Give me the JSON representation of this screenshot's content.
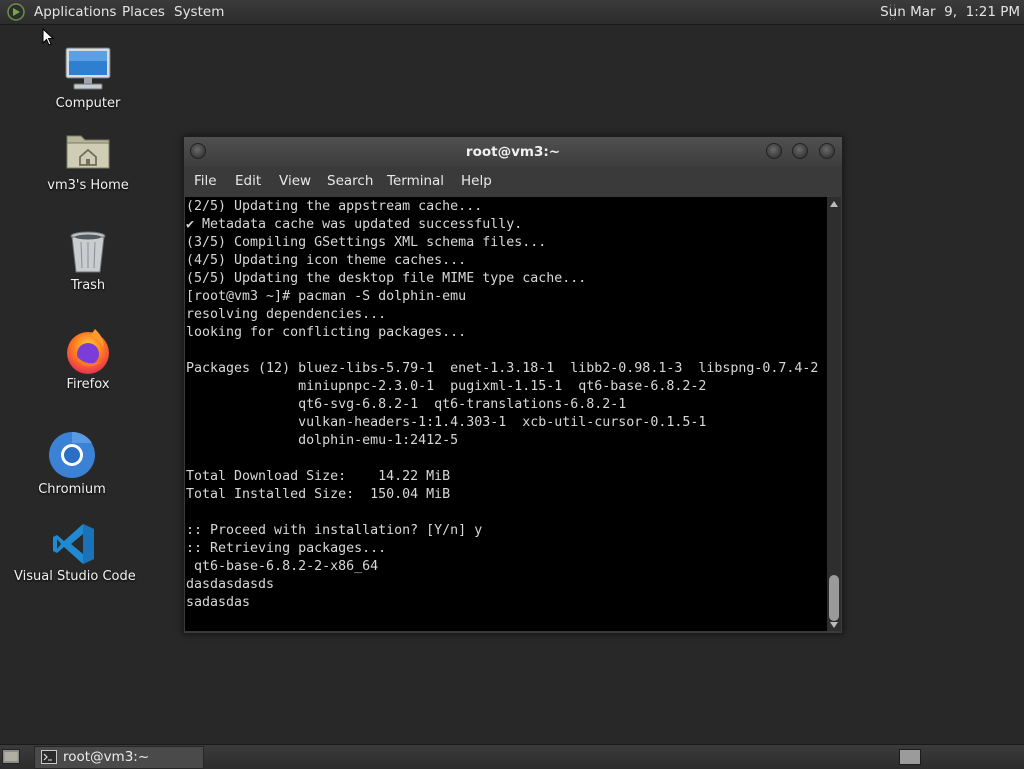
{
  "top_panel": {
    "menus": [
      "Applications",
      "Places",
      "System"
    ],
    "clock": "Sun Mar  9,  1:21 PM"
  },
  "desktop": {
    "icons": [
      {
        "label": "Computer",
        "icon": "computer-icon"
      },
      {
        "label": "vm3's Home",
        "icon": "home-folder-icon"
      },
      {
        "label": "Trash",
        "icon": "trash-icon"
      },
      {
        "label": "Firefox",
        "icon": "firefox-icon"
      },
      {
        "label": "Chromium",
        "icon": "chromium-icon"
      },
      {
        "label": "Visual Studio Code",
        "icon": "vscode-icon"
      }
    ]
  },
  "terminal": {
    "title": "root@vm3:~",
    "menu": [
      "File",
      "Edit",
      "View",
      "Search",
      "Terminal",
      "Help"
    ],
    "lines": [
      "(2/5) Updating the appstream cache...",
      "✔ Metadata cache was updated successfully.",
      "(3/5) Compiling GSettings XML schema files...",
      "(4/5) Updating icon theme caches...",
      "(5/5) Updating the desktop file MIME type cache...",
      "[root@vm3 ~]# pacman -S dolphin-emu",
      "resolving dependencies...",
      "looking for conflicting packages...",
      "",
      "Packages (12) bluez-libs-5.79-1  enet-1.3.18-1  libb2-0.98.1-3  libspng-0.7.4-2",
      "              miniupnpc-2.3.0-1  pugixml-1.15-1  qt6-base-6.8.2-2",
      "              qt6-svg-6.8.2-1  qt6-translations-6.8.2-1",
      "              vulkan-headers-1:1.4.303-1  xcb-util-cursor-0.1.5-1",
      "              dolphin-emu-1:2412-5",
      "",
      "Total Download Size:    14.22 MiB",
      "Total Installed Size:  150.04 MiB",
      "",
      ":: Proceed with installation? [Y/n] y",
      ":: Retrieving packages...",
      " qt6-base-6.8.2-2-x86_64",
      "dasdasdasds",
      "sadasdas"
    ]
  },
  "taskbar": {
    "window_label": "root@vm3:~"
  },
  "colors": {
    "desktop_bg": "#282828",
    "panel_bg": "#333333",
    "terminal_bg": "#000000",
    "terminal_fg": "#d8d8d8",
    "firefox_orange": "#ff7a1f",
    "chromium_blue": "#3b82d6",
    "vscode_blue": "#1f8ad2"
  }
}
